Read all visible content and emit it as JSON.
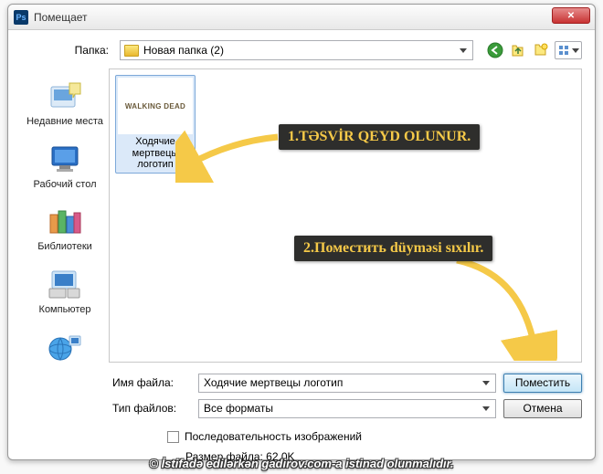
{
  "window": {
    "title": "Помещает",
    "ps_badge": "Ps"
  },
  "path": {
    "label": "Папка:",
    "value": "Новая папка (2)"
  },
  "sidebar": {
    "items": [
      {
        "label": "Недавние места"
      },
      {
        "label": "Рабочий стол"
      },
      {
        "label": "Библиотеки"
      },
      {
        "label": "Компьютер"
      },
      {
        "label": ""
      }
    ]
  },
  "file": {
    "thumb_text": "WALKING DEAD",
    "thumb_label": "Ходячие мертвецы логотип"
  },
  "form": {
    "filename_label": "Имя файла:",
    "filename_value": "Ходячие мертвецы логотип",
    "filetype_label": "Тип файлов:",
    "filetype_value": "Все форматы",
    "place_btn": "Поместить",
    "cancel_btn": "Отмена",
    "sequence_check": "Последовательность изображений",
    "size_label": "Размер файла: 62,0K"
  },
  "annotations": {
    "a1": "1.TƏSVİR QEYD OLUNUR.",
    "a2": "2.Поместить düyməsi sıxılır."
  },
  "footer": "© İstifadə edilərkən gadirov.com-a istinad olunmalıdır."
}
